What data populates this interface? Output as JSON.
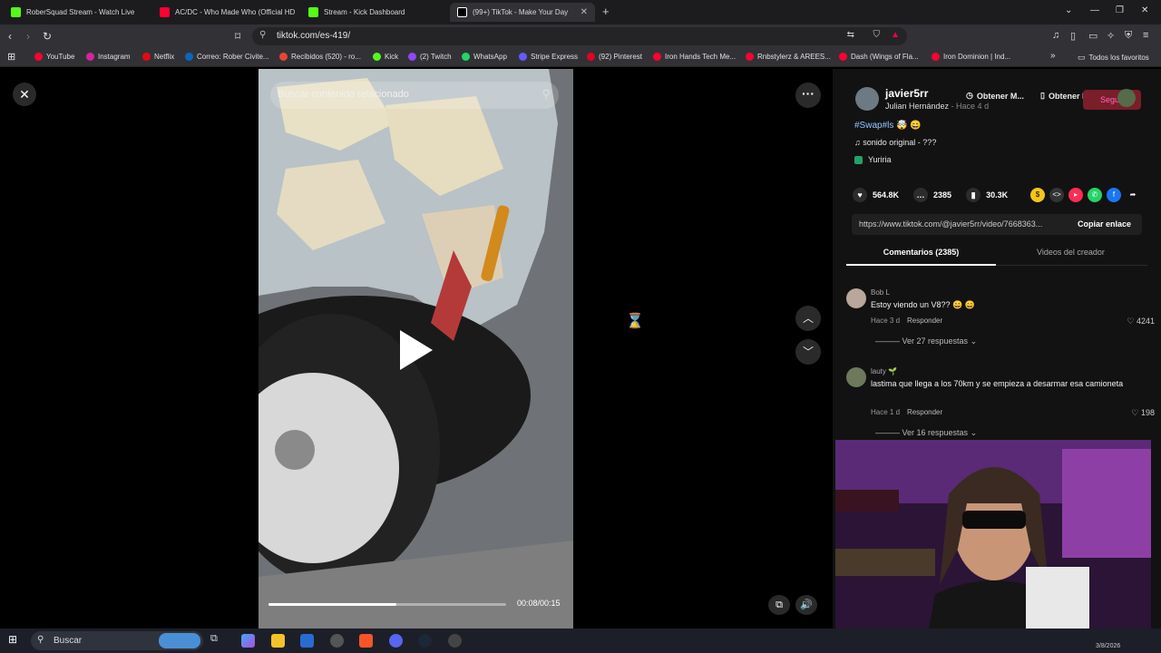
{
  "browser": {
    "tabs": [
      {
        "title": "RoberSquad Stream - Watch Live",
        "color": "#53fc18"
      },
      {
        "title": "AC/DC - Who Made Who (Official HD",
        "color": "#ff0033"
      },
      {
        "title": "Stream - Kick Dashboard",
        "color": "#53fc18"
      },
      {
        "title": "(99+) TikTok - Make Your Day",
        "color": "#ffffff"
      }
    ],
    "url": "tiktok.com/es-419/",
    "bookmarks": [
      {
        "label": "YouTube",
        "color": "#ff0033"
      },
      {
        "label": "Instagram",
        "color": "#d6249f"
      },
      {
        "label": "Netflix",
        "color": "#e50914"
      },
      {
        "label": "Correo: Rober Civite...",
        "color": "#0a66c2"
      },
      {
        "label": "Recibidos (520) - ro...",
        "color": "#ea4335"
      },
      {
        "label": "Kick",
        "color": "#53fc18"
      },
      {
        "label": "(2) Twitch",
        "color": "#9146ff"
      },
      {
        "label": "WhatsApp",
        "color": "#25d366"
      },
      {
        "label": "Stripe Express",
        "color": "#635bff"
      },
      {
        "label": "(92) Pinterest",
        "color": "#e60023"
      },
      {
        "label": "Iron Hands Tech Me...",
        "color": "#ff0033"
      },
      {
        "label": "Rnbstylerz & AREES...",
        "color": "#ff0033"
      },
      {
        "label": "Dash (Wings of Fla...",
        "color": "#ff0033"
      },
      {
        "label": "Iron Dominion | Ind...",
        "color": "#ff0033"
      }
    ],
    "all_favorites": "Todos los favoritos"
  },
  "video": {
    "search_placeholder": "Buscar contenido relacionado",
    "time": "00:08/00:15",
    "progress": 0.54
  },
  "creator": {
    "username": "javier5rr",
    "display_name": "Julian Hernández",
    "posted": "Hace 4 d",
    "get_mobile": "Obtener M...",
    "get_app": "Obtener la ...",
    "follow": "Seguir"
  },
  "post": {
    "hashtags": "#Swap#ls 🤯 😄",
    "sound": "sonido original - ???",
    "tag": "Yuriria",
    "likes": "564.8K",
    "comments": "2385",
    "saves": "30.3K",
    "link": "https://www.tiktok.com/@javier5rr/video/7668363...",
    "copy_link": "Copiar enlace"
  },
  "tabs": {
    "comments": "Comentarios (2385)",
    "creator_videos": "Videos del creador"
  },
  "comments": [
    {
      "user": "Bob L",
      "text": "Estoy viendo un V8?? 😄 😄",
      "when": "Hace 3 d",
      "reply": "Responder",
      "likes": "4241",
      "replies": "Ver 27 respuestas"
    },
    {
      "user": "lauty 🌱",
      "text": "lastima que llega a los 70km y se empieza a desarmar esa camioneta",
      "when": "Hace 1 d",
      "reply": "Responder",
      "likes": "198",
      "replies": "Ver 16 respuestas"
    }
  ],
  "taskbar": {
    "search": "Buscar",
    "date": "3/8/2026"
  }
}
